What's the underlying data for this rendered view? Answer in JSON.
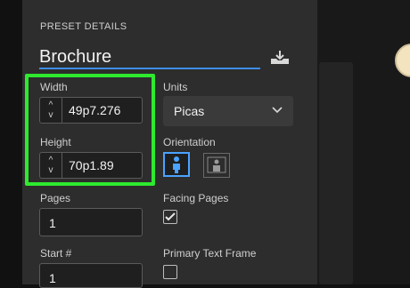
{
  "panel": {
    "section_title": "PRESET DETAILS",
    "preset_name": "Brochure"
  },
  "fields": {
    "width": {
      "label": "Width",
      "value": "49p7.276"
    },
    "height": {
      "label": "Height",
      "value": "70p1.89"
    },
    "pages": {
      "label": "Pages",
      "value": "1"
    },
    "start": {
      "label": "Start #",
      "value": "1"
    }
  },
  "units": {
    "label": "Units",
    "selected": "Picas"
  },
  "orientation": {
    "label": "Orientation",
    "selected": "portrait"
  },
  "facing_pages": {
    "label": "Facing Pages",
    "checked": true
  },
  "primary_text_frame": {
    "label": "Primary Text Frame",
    "checked": false
  },
  "stepper": {
    "up": "^",
    "down": "v"
  },
  "icons": [
    "save-preset-icon",
    "chevron-down-icon",
    "portrait-icon",
    "landscape-icon",
    "checkmark-icon"
  ],
  "colors": {
    "accent_blue": "#3e8ee8",
    "highlight_green": "#2eea2e",
    "panel_bg": "#2d2d2d"
  }
}
